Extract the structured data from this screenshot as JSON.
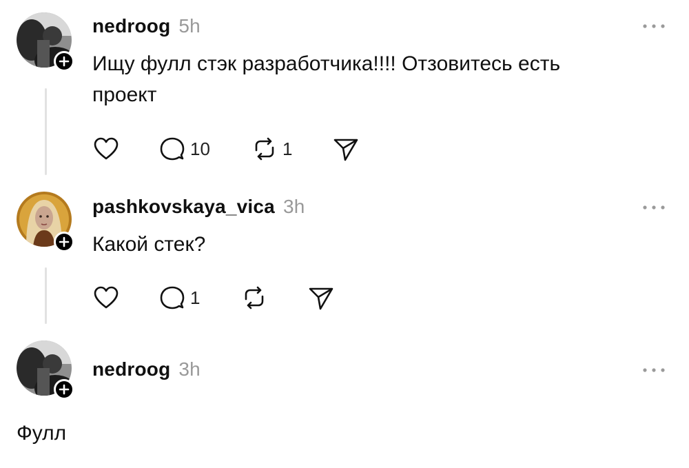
{
  "posts": [
    {
      "username": "nedroog",
      "time": "5h",
      "text": "Ищу фулл стэк разработчика!!!! Отзовитесь есть проект",
      "likes": "",
      "comments": "10",
      "reposts": "1"
    },
    {
      "username": "pashkovskaya_vica",
      "time": "3h",
      "text": "Какой стек?",
      "likes": "",
      "comments": "1",
      "reposts": ""
    },
    {
      "username": "nedroog",
      "time": "3h",
      "text": "Фулл"
    }
  ],
  "icons": {
    "like": "heart-icon",
    "comment": "comment-bubble-icon",
    "repost": "repost-icon",
    "share": "send-icon",
    "more": "more-dots-icon",
    "follow": "plus-icon"
  },
  "colors": {
    "text": "#101010",
    "muted": "#999999",
    "thread_line": "#e2e2e2",
    "badge": "#000000"
  }
}
